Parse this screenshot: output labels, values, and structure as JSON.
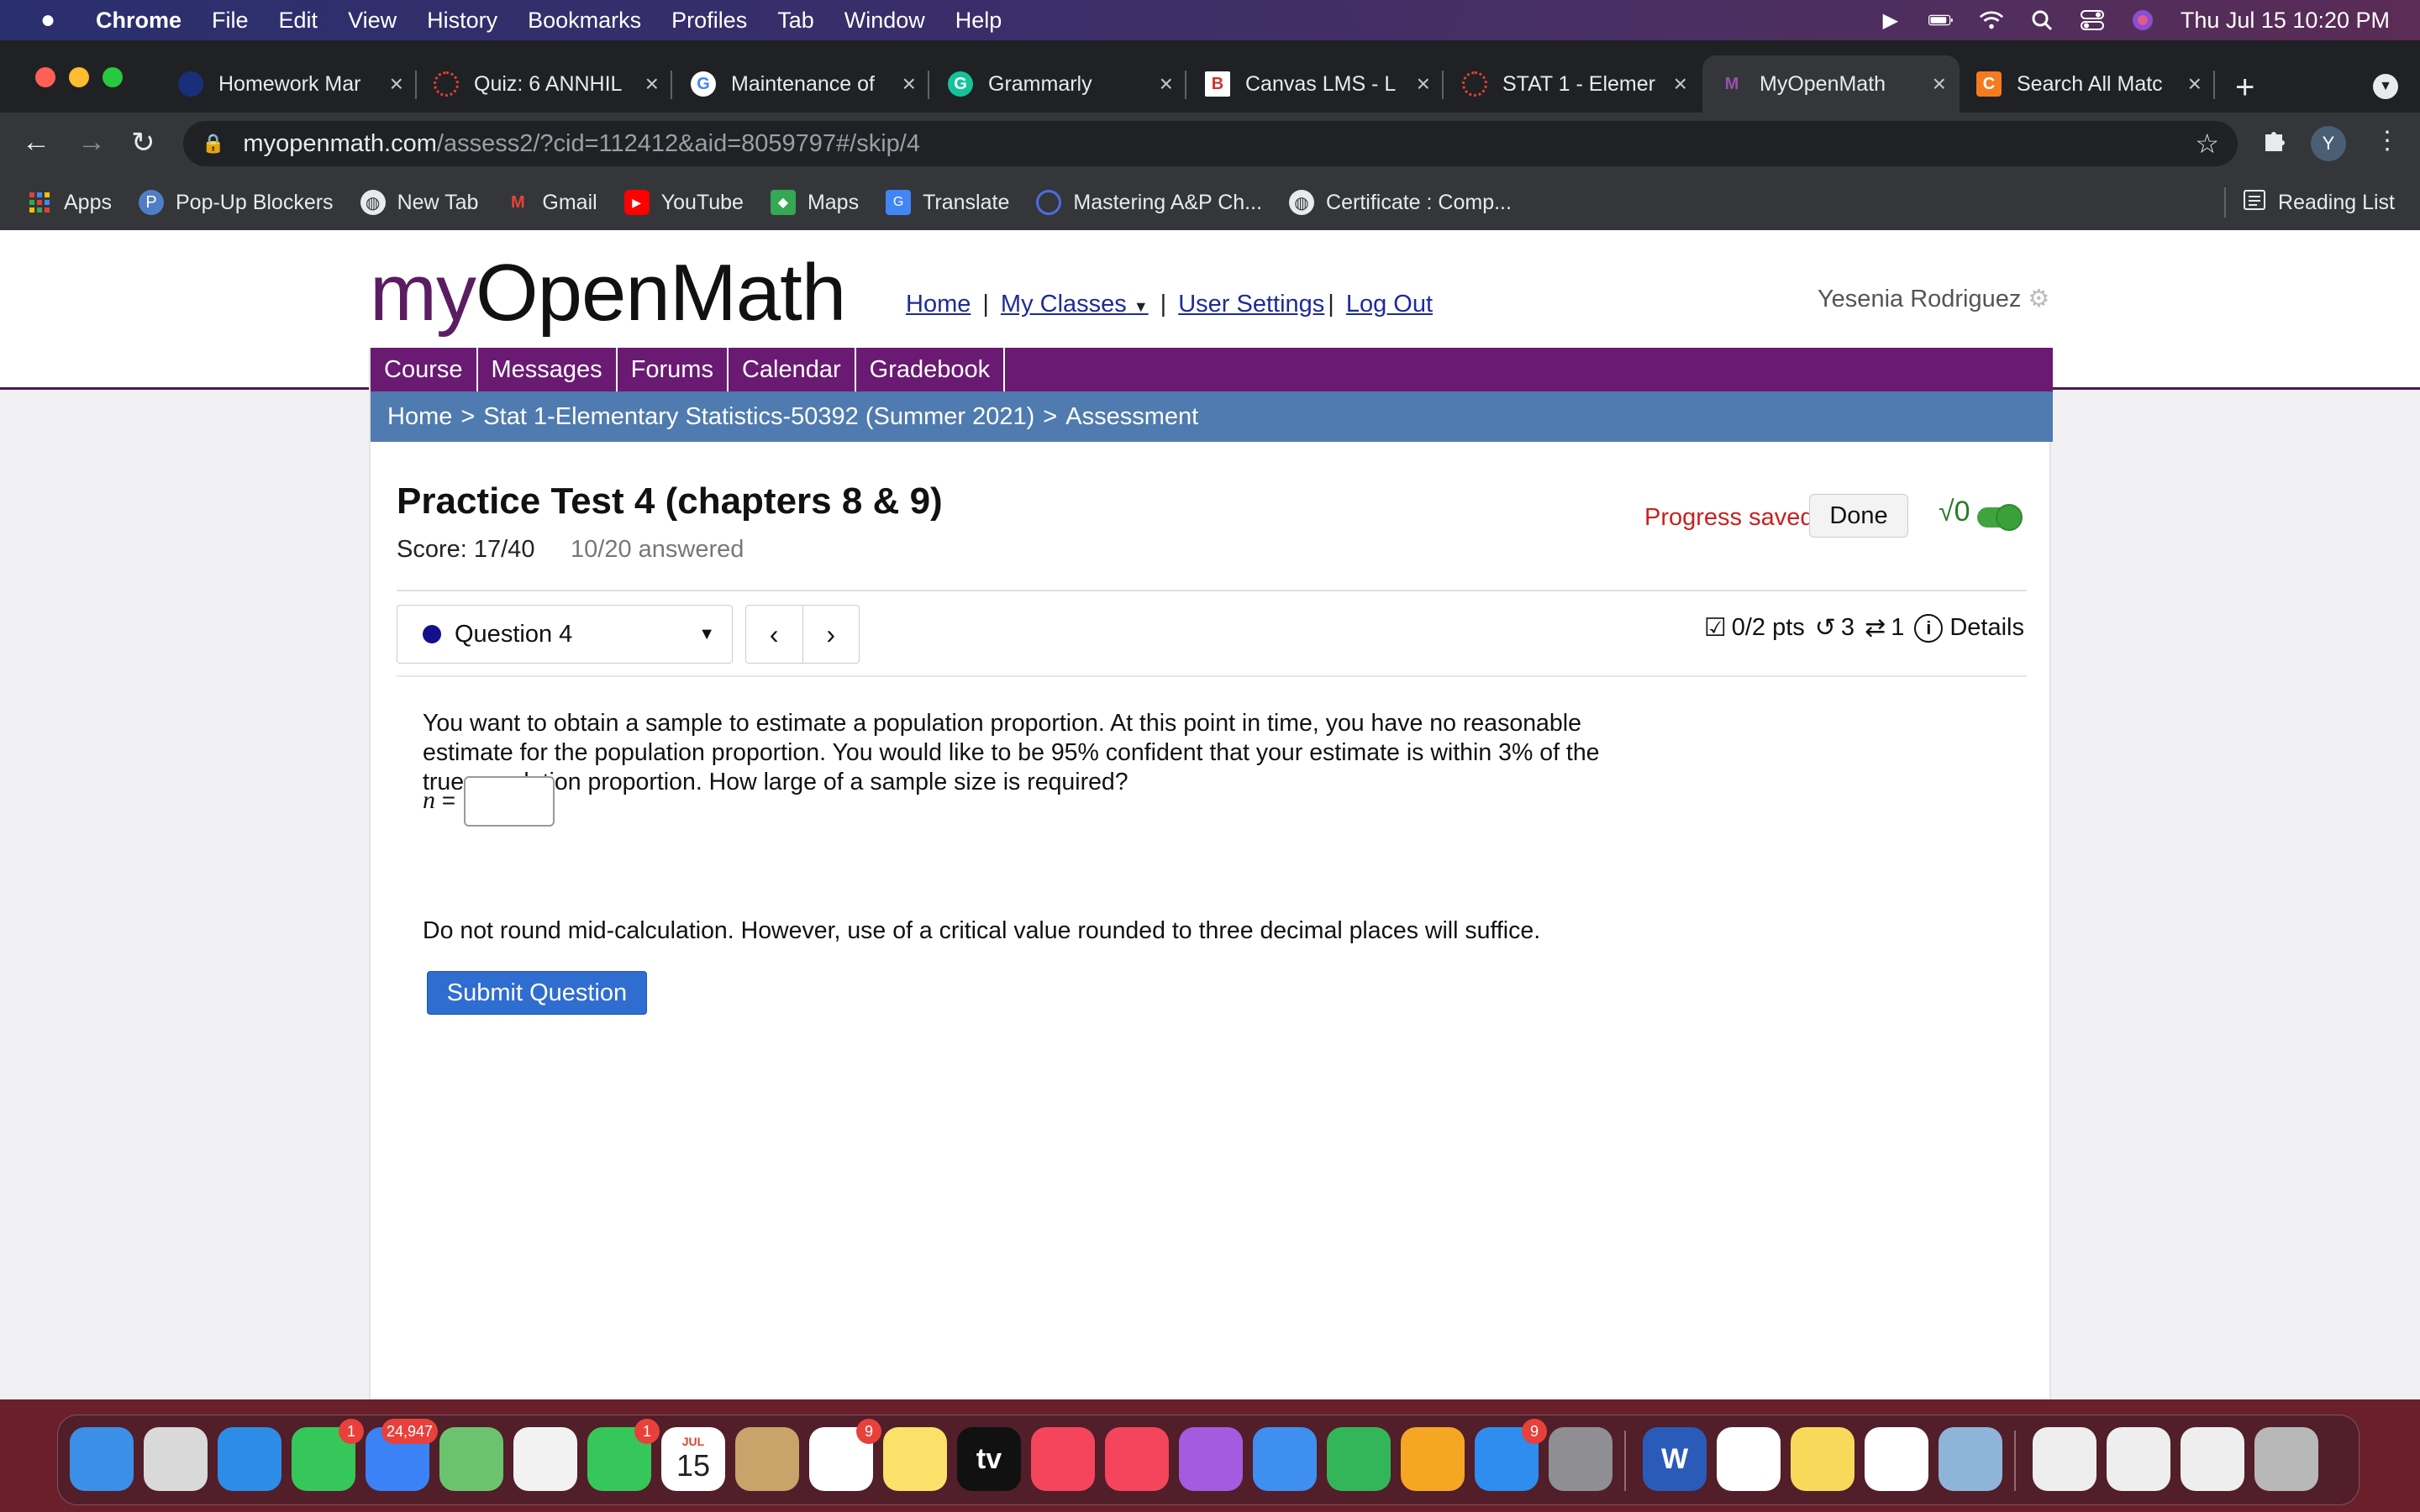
{
  "menubar": {
    "app": "Chrome",
    "items": [
      "File",
      "Edit",
      "View",
      "History",
      "Bookmarks",
      "Profiles",
      "Tab",
      "Window",
      "Help"
    ],
    "clock": "Thu Jul 15  10:20 PM"
  },
  "tabs": [
    {
      "title": "Homework Mar",
      "icon": "homework-icon",
      "color": "#1a2f7a"
    },
    {
      "title": "Quiz: 6 ANNHIL",
      "icon": "canvas-icon",
      "color": "#e0422f"
    },
    {
      "title": "Maintenance of",
      "icon": "google-icon",
      "color": "#ffffff"
    },
    {
      "title": "Grammarly",
      "icon": "grammarly-icon",
      "color": "#15c39a"
    },
    {
      "title": "Canvas LMS - L",
      "icon": "b-icon",
      "color": "#d0312d"
    },
    {
      "title": "STAT 1 - Elemer",
      "icon": "canvas-icon",
      "color": "#e0422f"
    },
    {
      "title": "MyOpenMath",
      "icon": "myopenmath-icon",
      "color": "#7a2b8a"
    },
    {
      "title": "Search All Matc",
      "icon": "c-icon",
      "color": "#f47b20"
    }
  ],
  "address": {
    "host": "myopenmath.com",
    "path": "/assess2/?cid=112412&aid=8059797#/skip/4"
  },
  "profile_initial": "Y",
  "bookmarks": [
    {
      "label": "Apps",
      "icon": "apps-grid-icon"
    },
    {
      "label": "Pop-Up Blockers",
      "icon": "p-icon"
    },
    {
      "label": "New Tab",
      "icon": "globe-icon"
    },
    {
      "label": "Gmail",
      "icon": "gmail-icon"
    },
    {
      "label": "YouTube",
      "icon": "youtube-icon"
    },
    {
      "label": "Maps",
      "icon": "maps-icon"
    },
    {
      "label": "Translate",
      "icon": "translate-icon"
    },
    {
      "label": "Mastering A&P Ch...",
      "icon": "q-icon"
    },
    {
      "label": "Certificate : Comp...",
      "icon": "globe-icon"
    }
  ],
  "reading_list": "Reading List",
  "site": {
    "logo_my": "my",
    "logo_rest": "OpenMath",
    "nav": {
      "home": "Home",
      "sep1": "|",
      "classes": "My Classes",
      "sep2": "|",
      "settings": "User Settings",
      "sep3": "|",
      "logout": "Log Out"
    },
    "user": "Yesenia Rodriguez",
    "course_nav": [
      "Course",
      "Messages",
      "Forums",
      "Calendar",
      "Gradebook"
    ],
    "breadcrumbs": {
      "home": "Home",
      "course": "Stat 1-Elementary Statistics-50392 (Summer 2021)",
      "current": "Assessment",
      "sep": ">"
    }
  },
  "assessment": {
    "title": "Practice Test 4 (chapters 8 & 9)",
    "score": "Score: 17/40",
    "answered": "10/20 answered",
    "progress_saved": "Progress saved",
    "done": "Done",
    "math_toggle": "√0",
    "question_label": "Question 4",
    "points": "0/2 pts",
    "retries": "3",
    "regens": "1",
    "details": "Details",
    "question_text": "You want to obtain a sample to estimate a population proportion. At this point in time, you have no reasonable estimate for the population proportion. You would like to be 95% confident that your estimate is within 3% of the true population proportion. How large of a sample size is required?",
    "n_label_var": "n",
    "n_label_eq": " =",
    "n_value": "",
    "note": "Do not round mid-calculation. However, use of a critical value rounded to three decimal places will suffice.",
    "submit": "Submit Question"
  },
  "dock": {
    "apps": [
      {
        "name": "finder",
        "color": "#3b8fe6"
      },
      {
        "name": "launchpad",
        "color": "#d9d9d9"
      },
      {
        "name": "safari",
        "color": "#2d8de6"
      },
      {
        "name": "messages",
        "color": "#35c759",
        "badge": "1"
      },
      {
        "name": "mail",
        "color": "#3a82f6",
        "badge": "24,947"
      },
      {
        "name": "maps",
        "color": "#6cc36f"
      },
      {
        "name": "photos",
        "color": "#f2f2f2"
      },
      {
        "name": "facetime",
        "color": "#35c759",
        "badge": "1"
      },
      {
        "name": "calendar",
        "color": "#ffffff",
        "month": "JUL",
        "day": "15"
      },
      {
        "name": "contacts",
        "color": "#c8a46a"
      },
      {
        "name": "reminders",
        "color": "#ffffff",
        "badge": "9"
      },
      {
        "name": "notes",
        "color": "#fbe06a"
      },
      {
        "name": "apple-tv",
        "color": "#111111",
        "label": "tv"
      },
      {
        "name": "music",
        "color": "#f5455c"
      },
      {
        "name": "news",
        "color": "#f5455c"
      },
      {
        "name": "podcasts",
        "color": "#a55be0"
      },
      {
        "name": "keynote",
        "color": "#3f8ff0"
      },
      {
        "name": "numbers",
        "color": "#33b65a"
      },
      {
        "name": "pages",
        "color": "#f5a623"
      },
      {
        "name": "app-store",
        "color": "#2f8df0",
        "badge": "9"
      },
      {
        "name": "system-preferences",
        "color": "#8e8e93"
      },
      {
        "name": "word",
        "color": "#2b5bb8",
        "label": "W"
      },
      {
        "name": "chrome",
        "color": "#ffffff"
      },
      {
        "name": "stickies",
        "color": "#f8d95a"
      },
      {
        "name": "google-play",
        "color": "#ffffff"
      },
      {
        "name": "preview",
        "color": "#8fb4d9"
      },
      {
        "name": "doc-stack-1",
        "color": "#eeeeee"
      },
      {
        "name": "doc-stack-2",
        "color": "#eeeeee"
      },
      {
        "name": "doc-stack-3",
        "color": "#eeeeee"
      },
      {
        "name": "trash",
        "color": "#b8b8b8"
      }
    ]
  }
}
